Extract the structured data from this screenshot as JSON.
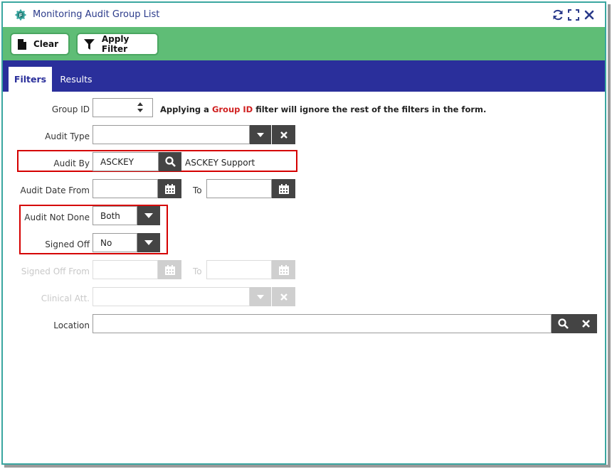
{
  "window": {
    "title": "Monitoring Audit Group List"
  },
  "toolbar": {
    "clear_label": "Clear",
    "apply_filter_label": "Apply Filter"
  },
  "tabs": [
    {
      "label": "Filters",
      "active": true
    },
    {
      "label": "Results",
      "active": false
    }
  ],
  "form": {
    "group_id": {
      "label": "Group ID",
      "value": ""
    },
    "note": {
      "prefix": "Applying a ",
      "highlight": "Group ID",
      "suffix": " filter will ignore the rest of the filters in the form."
    },
    "audit_type": {
      "label": "Audit Type",
      "value": ""
    },
    "audit_by": {
      "label": "Audit By",
      "code": "ASCKEY",
      "name": "ASCKEY Support"
    },
    "audit_date": {
      "label": "Audit Date From",
      "to_label": "To",
      "from": "",
      "to": ""
    },
    "audit_not_done": {
      "label": "Audit Not Done",
      "value": "Both"
    },
    "signed_off": {
      "label": "Signed Off",
      "value": "No"
    },
    "signed_off_from": {
      "label": "Signed Off From",
      "to_label": "To",
      "from": "",
      "to": ""
    },
    "clinical_att": {
      "label": "Clinical Att.",
      "value": ""
    },
    "location": {
      "label": "Location",
      "value": ""
    }
  },
  "colors": {
    "toolbar_green": "#5fbd76",
    "tab_blue": "#2a2f9b",
    "title_blue": "#2a3a8a",
    "highlight_red": "#d50000"
  }
}
